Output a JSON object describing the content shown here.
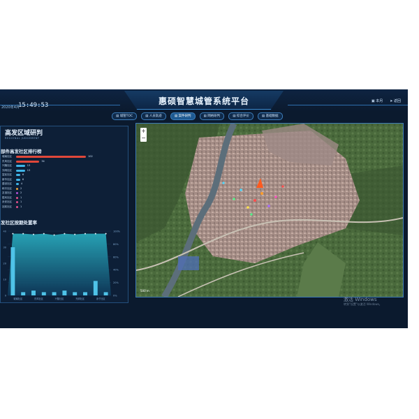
{
  "header": {
    "date": "2020年4月",
    "time": "15:49:53",
    "title": "惠硕智慧城管系统平台",
    "ctrl_home": "本月",
    "ctrl_return": "返回"
  },
  "tabs": [
    {
      "label": "城管TOC",
      "active": false
    },
    {
      "label": "人员轨迹",
      "active": false
    },
    {
      "label": "案件研判",
      "active": true
    },
    {
      "label": "网格研判",
      "active": false
    },
    {
      "label": "综合评价",
      "active": false
    },
    {
      "label": "基础数据",
      "active": false
    }
  ],
  "left_panel": {
    "title": "高发区域研判",
    "subtitle": "REGIONAL JUDGEMENT",
    "ranking_title": "部件高发社区排行榜",
    "ranking": [
      {
        "name": "城南社区",
        "value": 102,
        "color": "#e0473a"
      },
      {
        "name": "东风社区",
        "value": 34,
        "color": "#e0473a"
      },
      {
        "name": "兴隆社区",
        "value": 13,
        "color": "#3fb5e8"
      },
      {
        "name": "光明社区",
        "value": 13,
        "color": "#3fb5e8"
      },
      {
        "name": "富民社区",
        "value": 6,
        "color": "#3fb5e8"
      },
      {
        "name": "新华社区",
        "value": 6,
        "color": "#3fb5e8"
      },
      {
        "name": "建设社区",
        "value": 4,
        "color": "#3fb5e8"
      },
      {
        "name": "和平社区",
        "value": 2,
        "color": "#e8a23a"
      },
      {
        "name": "友谊社区",
        "value": 2,
        "color": "#b04fd6"
      },
      {
        "name": "胜利社区",
        "value": 1,
        "color": "#e04f8a"
      },
      {
        "name": "永安社区",
        "value": 1,
        "color": "#e04f8a"
      },
      {
        "name": "站前社区",
        "value": 1,
        "color": "#e04f8a"
      }
    ],
    "rate_title": "发社区按期处置率"
  },
  "chart_data": {
    "type": "bar",
    "title": "发社区按期处置率",
    "categories": [
      "城南社区",
      "东风社区",
      "兴隆社区",
      "光明社区",
      "永宁社区"
    ],
    "series": [
      {
        "values": [
          30,
          2,
          3,
          2,
          2,
          3,
          2,
          2,
          9,
          2
        ],
        "color": "#4fc3e8"
      },
      {
        "values": [
          96,
          96,
          95,
          96,
          94,
          96,
          95,
          96,
          96,
          96
        ],
        "color": "#2a8aa8"
      }
    ],
    "left_ticks": [
      "40",
      "30",
      "20",
      "10",
      "0"
    ],
    "right_ticks": [
      "100%",
      "80%",
      "60%",
      "40%",
      "20%",
      "0%"
    ],
    "ylim": [
      0,
      40
    ]
  },
  "map": {
    "zoom_in": "+",
    "zoom_out": "−",
    "scale": "500 m",
    "colors": {
      "vegetation": "#4d6b3e",
      "urban": "#a9918a",
      "river": "#5c6e7a"
    }
  },
  "watermark": {
    "line1": "激活 Windows",
    "line2": "转到\"设置\"以激活 Windows。"
  }
}
